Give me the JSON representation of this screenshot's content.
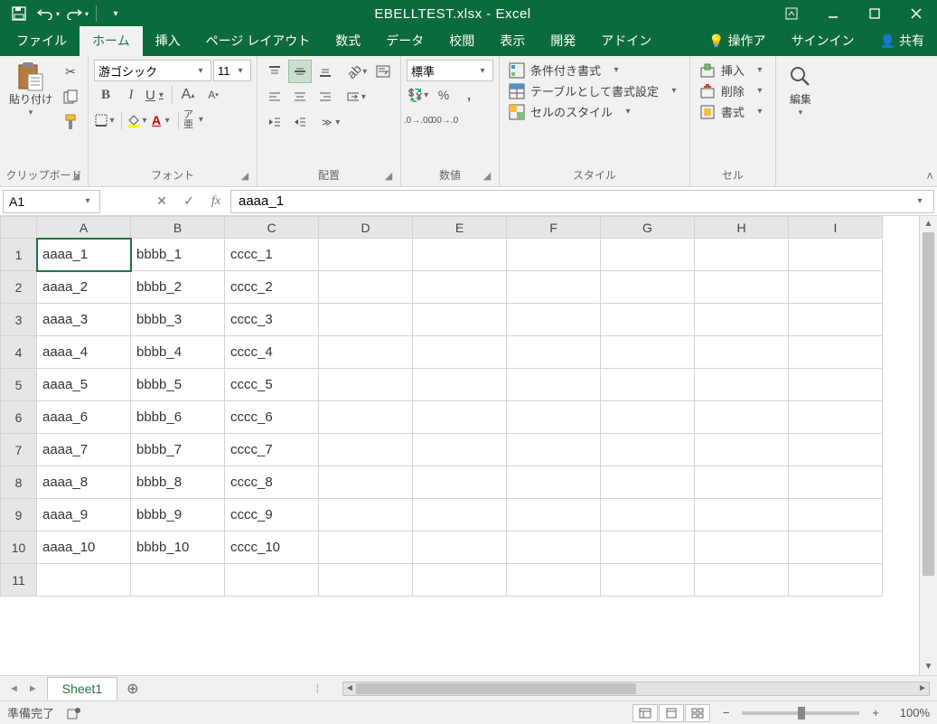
{
  "title": "EBELLTEST.xlsx - Excel",
  "tabs": [
    "ファイル",
    "ホーム",
    "挿入",
    "ページ レイアウト",
    "数式",
    "データ",
    "校閲",
    "表示",
    "開発",
    "アドイン"
  ],
  "tabs_active_index": 1,
  "tell_me": "操作ア",
  "signin": "サインイン",
  "share": "共有",
  "ribbon": {
    "clipboard": {
      "label": "クリップボード",
      "paste": "貼り付け"
    },
    "font": {
      "label": "フォント",
      "name": "游ゴシック",
      "size": "11",
      "bold": "B",
      "italic": "I",
      "underline": "U",
      "grow": "A",
      "shrink": "A",
      "ruby": "ア亜"
    },
    "align": {
      "label": "配置"
    },
    "number": {
      "label": "数値",
      "format": "標準"
    },
    "style": {
      "label": "スタイル",
      "cond": "条件付き書式",
      "table": "テーブルとして書式設定",
      "cell": "セルのスタイル"
    },
    "cells": {
      "label": "セル",
      "insert": "挿入",
      "delete": "削除",
      "format": "書式"
    },
    "editing": {
      "label": "編集"
    }
  },
  "namebox": "A1",
  "formula": "aaaa_1",
  "columns": [
    "A",
    "B",
    "C",
    "D",
    "E",
    "F",
    "G",
    "H",
    "I"
  ],
  "rows": [
    1,
    2,
    3,
    4,
    5,
    6,
    7,
    8,
    9,
    10,
    11
  ],
  "cells": {
    "1": [
      "aaaa_1",
      "bbbb_1",
      "cccc_1"
    ],
    "2": [
      "aaaa_2",
      "bbbb_2",
      "cccc_2"
    ],
    "3": [
      "aaaa_3",
      "bbbb_3",
      "cccc_3"
    ],
    "4": [
      "aaaa_4",
      "bbbb_4",
      "cccc_4"
    ],
    "5": [
      "aaaa_5",
      "bbbb_5",
      "cccc_5"
    ],
    "6": [
      "aaaa_6",
      "bbbb_6",
      "cccc_6"
    ],
    "7": [
      "aaaa_7",
      "bbbb_7",
      "cccc_7"
    ],
    "8": [
      "aaaa_8",
      "bbbb_8",
      "cccc_8"
    ],
    "9": [
      "aaaa_9",
      "bbbb_9",
      "cccc_9"
    ],
    "10": [
      "aaaa_10",
      "bbbb_10",
      "cccc_10"
    ],
    "11": [
      "",
      "",
      ""
    ]
  },
  "selected_cell": {
    "row": 1,
    "col": 0
  },
  "sheet": "Sheet1",
  "status": "準備完了",
  "zoom": "100%"
}
